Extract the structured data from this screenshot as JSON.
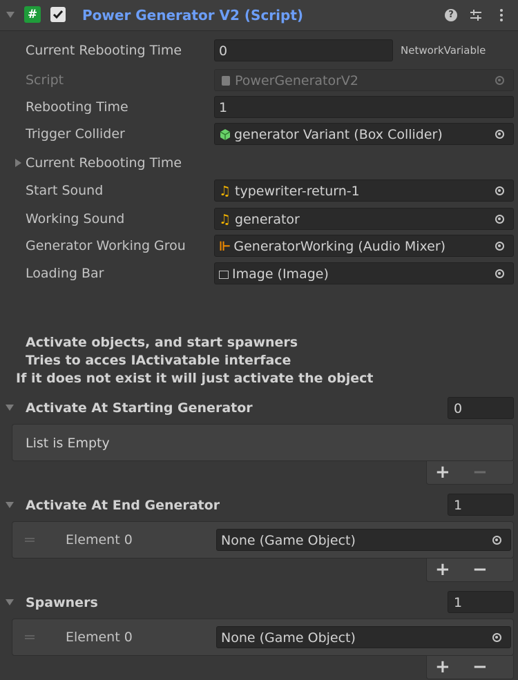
{
  "component": {
    "title": "Power Generator V2 (Script)",
    "enabled": true
  },
  "colors": {
    "title": "#6c9ef8",
    "audio_icon": "#f4b400",
    "mixer_icon": "#f08a00",
    "prefab_icon": "#6ad16a"
  },
  "fields": {
    "current_rebooting_time": {
      "label": "Current Rebooting Time",
      "value": "0",
      "tag": "NetworkVariable"
    },
    "script": {
      "label": "Script",
      "value": "PowerGeneratorV2"
    },
    "rebooting_time": {
      "label": "Rebooting Time",
      "value": "1"
    },
    "trigger_collider": {
      "label": "Trigger Collider",
      "value": "generator Variant (Box Collider)"
    },
    "current_rebooting_time_foldout": {
      "label": "Current Rebooting Time"
    },
    "start_sound": {
      "label": "Start Sound",
      "value": "typewriter-return-1"
    },
    "working_sound": {
      "label": "Working Sound",
      "value": "generator"
    },
    "generator_working_group": {
      "label": "Generator Working Grou",
      "value": "GeneratorWorking (Audio Mixer)"
    },
    "loading_bar": {
      "label": "Loading Bar",
      "value": "Image (Image)"
    }
  },
  "help": {
    "line1": "Activate objects, and start spawners",
    "line2": "Tries to acces IActivatable interface",
    "line3": "If it does not exist it will just activate the object"
  },
  "lists": {
    "starting": {
      "label": "Activate At Starting Generator",
      "count": "0",
      "empty_text": "List is Empty"
    },
    "end": {
      "label": "Activate At End Generator",
      "count": "1",
      "element_label": "Element 0",
      "element_value": "None (Game Object)"
    },
    "spawners": {
      "label": "Spawners",
      "count": "1",
      "element_label": "Element 0",
      "element_value": "None (Game Object)"
    }
  },
  "footer_buttons": {
    "plus": "+",
    "minus": "−"
  }
}
